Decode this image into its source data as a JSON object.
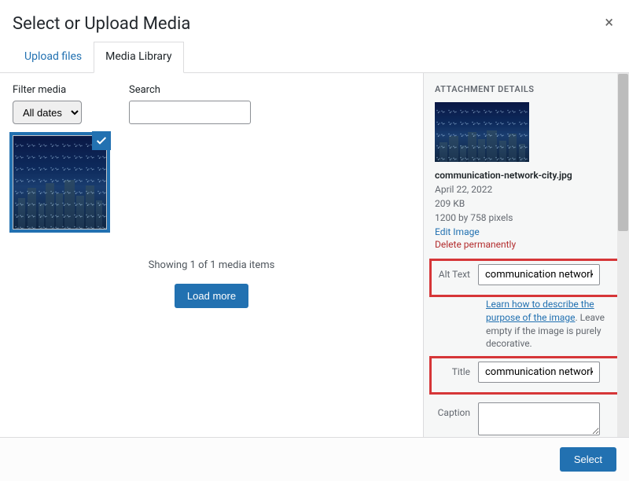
{
  "header": {
    "title": "Select or Upload Media",
    "close_glyph": "×"
  },
  "tabs": [
    {
      "label": "Upload files",
      "active": false
    },
    {
      "label": "Media Library",
      "active": true
    }
  ],
  "filters": {
    "filter_label": "Filter media",
    "date_select": "All dates",
    "search_label": "Search",
    "search_value": ""
  },
  "grid": {
    "status_text": "Showing 1 of 1 media items",
    "load_more_label": "Load more"
  },
  "sidebar": {
    "heading": "ATTACHMENT DETAILS",
    "filename": "communication-network-city.jpg",
    "date": "April 22, 2022",
    "filesize": "209 KB",
    "dimensions": "1200 by 758 pixels",
    "edit_link": "Edit Image",
    "delete_link": "Delete permanently",
    "fields": {
      "alt_label": "Alt Text",
      "alt_value": "communication network city",
      "help_link": "Learn how to describe the purpose of the image",
      "help_suffix": ". Leave empty if the image is purely decorative.",
      "title_label": "Title",
      "title_value": "communication network city",
      "caption_label": "Caption",
      "caption_value": ""
    }
  },
  "footer": {
    "select_label": "Select"
  }
}
